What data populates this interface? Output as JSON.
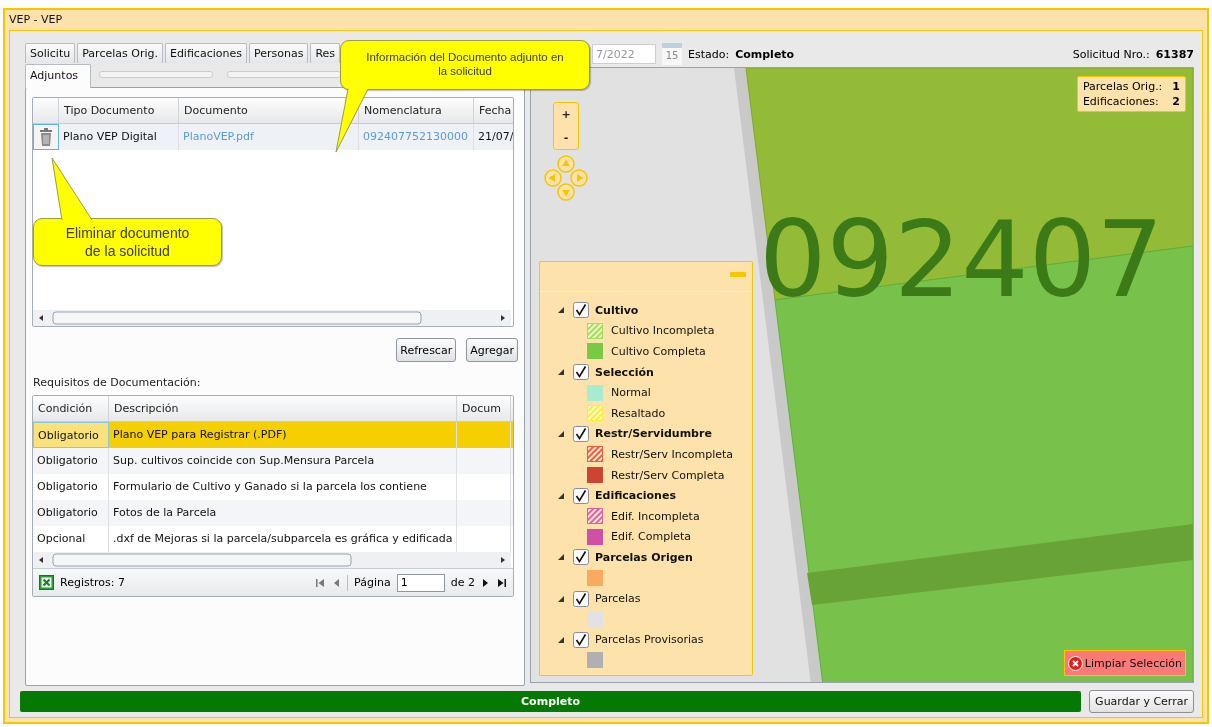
{
  "window": {
    "title": "VEP  -  VEP"
  },
  "tabs": [
    {
      "label": "Solicitu",
      "selected": false
    },
    {
      "label": "Parcelas Orig.",
      "selected": false
    },
    {
      "label": "Edificaciones",
      "selected": false
    },
    {
      "label": "Personas",
      "selected": false
    },
    {
      "label": "Res",
      "selected": false
    }
  ],
  "subtabs": [
    {
      "label": "Adjuntos",
      "selected": true
    }
  ],
  "attachments": {
    "columns": [
      "Tipo Documento",
      "Documento",
      "Nomenclatura",
      "Fecha"
    ],
    "rows": [
      {
        "cells": [
          {
            "text": "Plano VEP Digital",
            "link": false
          },
          {
            "text": "PlanoVEP.pdf",
            "link": true
          },
          {
            "text": "092407752130000",
            "link": true
          },
          {
            "text": "21/07/",
            "link": false
          }
        ]
      }
    ]
  },
  "actions": [
    "Refrescar",
    "Agregar"
  ],
  "requirements": {
    "title": "Requisitos de Documentación:",
    "columns": [
      "Condición",
      "Descripción",
      "Docum"
    ],
    "rows": [
      {
        "condicion": "Obligatorio",
        "descripcion": "Plano VEP para Registrar (.PDF)",
        "selected": true
      },
      {
        "condicion": "Obligatorio",
        "descripcion": "Sup. cultivos coincide con Sup.Mensura Parcela",
        "selected": false
      },
      {
        "condicion": "Obligatorio",
        "descripcion": "Formulario de Cultivo y Ganado si la parcela los contiene",
        "selected": false
      },
      {
        "condicion": "Obligatorio",
        "descripcion": "Fotos de la Parcela",
        "selected": false
      },
      {
        "condicion": "Opcional",
        "descripcion": ".dxf de Mejoras si la parcela/subparcela es gráfica y edificada",
        "selected": false
      }
    ],
    "footer": {
      "records": "Registros: 7",
      "page_label": "Página",
      "page_value": "1",
      "page_total": "de 2"
    }
  },
  "record_header": {
    "date_value": "7/2022",
    "calendar_day": "15",
    "estado_label": "Estado:",
    "estado_value": "Completo",
    "solicitud_label": "Solicitud Nro.:",
    "solicitud_value": "61387"
  },
  "map": {
    "parcel_label": "092407",
    "zoom_in": "+",
    "zoom_out": "-",
    "info": [
      {
        "label": "Parcelas Orig.:",
        "value": "1"
      },
      {
        "label": "Edificaciones:",
        "value": "2"
      }
    ],
    "clear_button": "Limpiar Selección"
  },
  "legend": [
    {
      "label": "Cultivo",
      "checked": true,
      "expanded": true,
      "bold": true,
      "children": [
        {
          "label": "Cultivo Incompleta",
          "color": "#9ee05a",
          "kind": "hatched"
        },
        {
          "label": "Cultivo Completa",
          "color": "#7ac943",
          "kind": "solid"
        }
      ]
    },
    {
      "label": "Selección",
      "checked": true,
      "expanded": true,
      "bold": true,
      "children": [
        {
          "label": "Normal",
          "color": "#a8ecd0",
          "kind": "solid"
        },
        {
          "label": "Resaltado",
          "color": "#f5ee3a",
          "kind": "hatched"
        }
      ]
    },
    {
      "label": "Restr/Servidumbre",
      "checked": true,
      "expanded": true,
      "bold": true,
      "children": [
        {
          "label": "Restr/Serv Incompleta",
          "color": "#f05a40",
          "kind": "hatched"
        },
        {
          "label": "Restr/Serv Completa",
          "color": "#cc4433",
          "kind": "solid"
        }
      ]
    },
    {
      "label": "Edificaciones",
      "checked": true,
      "expanded": true,
      "bold": true,
      "children": [
        {
          "label": "Edif. Incompleta",
          "color": "#e060a0",
          "kind": "hatched"
        },
        {
          "label": "Edif. Completa",
          "color": "#d050a8",
          "kind": "solid"
        }
      ]
    },
    {
      "label": "Parcelas Origen",
      "checked": true,
      "expanded": true,
      "bold": true,
      "children": [
        {
          "color": "#f8aa60",
          "kind": "solid"
        }
      ]
    },
    {
      "label": "Parcelas",
      "checked": true,
      "expanded": true,
      "bold": false,
      "children": [
        {
          "color": "#e2e2e2",
          "kind": "solid"
        }
      ]
    },
    {
      "label": "Parcelas Provisorias",
      "checked": true,
      "expanded": true,
      "bold": false,
      "children": [
        {
          "color": "#b0b0b0",
          "kind": "solid"
        }
      ]
    }
  ],
  "status_bar": {
    "label": "Completo"
  },
  "save_button": "Guardar y Cerrar",
  "callouts": [
    {
      "text": "Información del Documento adjunto en la solicitud"
    },
    {
      "text": "Eliminar documento de la solicitud"
    }
  ]
}
